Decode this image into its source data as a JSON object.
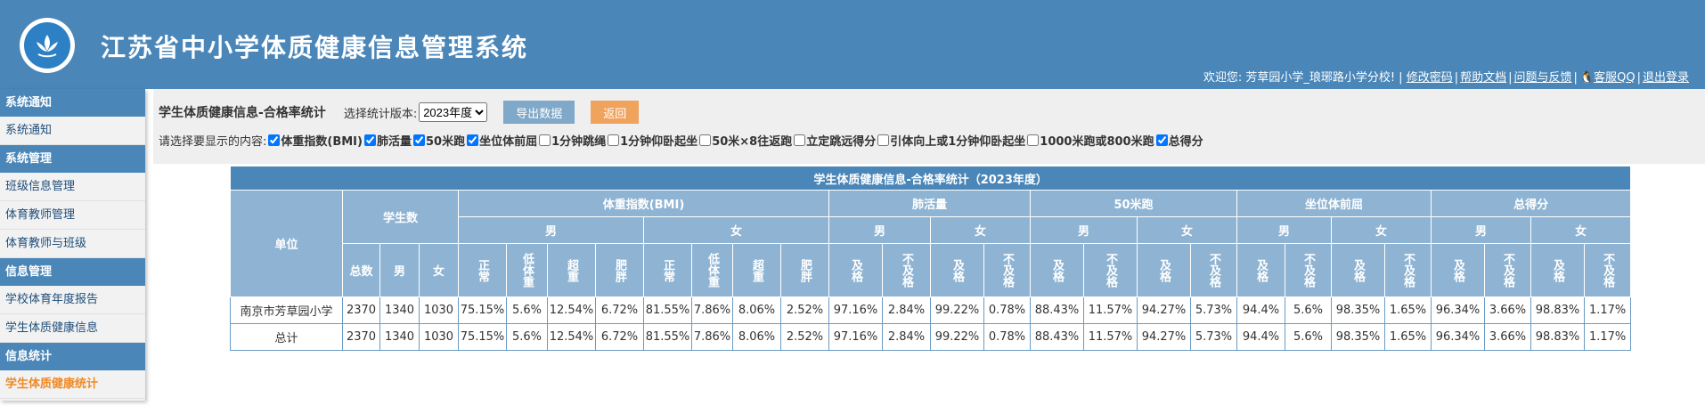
{
  "header": {
    "title": "江苏省中小学体质健康信息管理系统",
    "welcome": "欢迎您: 芳草园小学_琅琊路小学分校! |",
    "links": [
      "修改密码",
      "帮助文档",
      "问题与反馈",
      "客服QQ",
      "退出登录"
    ]
  },
  "sidebar": {
    "groups": [
      {
        "title": "系统通知",
        "items": [
          "系统通知"
        ]
      },
      {
        "title": "系统管理",
        "items": [
          "班级信息管理",
          "体育教师管理",
          "体育教师与班级"
        ]
      },
      {
        "title": "信息管理",
        "items": [
          "学校体育年度报告",
          "学生体质健康信息"
        ]
      },
      {
        "title": "信息统计",
        "items": [
          "学生体质健康统计"
        ]
      }
    ]
  },
  "filter": {
    "page_title": "学生体质健康信息-合格率统计",
    "version_label": "选择统计版本:",
    "version_selected": "2023年度",
    "export_label": "导出数据",
    "back_label": "返回",
    "content_label": "请选择要显示的内容:",
    "options": [
      {
        "label": "体重指数(BMI)",
        "checked": true
      },
      {
        "label": "肺活量",
        "checked": true
      },
      {
        "label": "50米跑",
        "checked": true
      },
      {
        "label": "坐位体前屈",
        "checked": true
      },
      {
        "label": "1分钟跳绳",
        "checked": false
      },
      {
        "label": "1分钟仰卧起坐",
        "checked": false
      },
      {
        "label": "50米×8往返跑",
        "checked": false
      },
      {
        "label": "立定跳远得分",
        "checked": false
      },
      {
        "label": "引体向上或1分钟仰卧起坐",
        "checked": false
      },
      {
        "label": "1000米跑或800米跑",
        "checked": false
      },
      {
        "label": "总得分",
        "checked": true
      }
    ]
  },
  "table": {
    "caption": "学生体质健康信息-合格率统计（2023年度）",
    "unit_header": "单位",
    "count_header": "学生数",
    "count_subs": [
      "总数",
      "男",
      "女"
    ],
    "groups": [
      "体重指数(BMI)",
      "肺活量",
      "50米跑",
      "坐位体前屈",
      "总得分"
    ],
    "sex": [
      "男",
      "女"
    ],
    "bmi_items": [
      "正常",
      "低体重",
      "超重",
      "肥胖"
    ],
    "pass_items": [
      "及格",
      "不及格"
    ],
    "rows": [
      {
        "unit": "南京市芳草园小学",
        "values": [
          "2370",
          "1340",
          "1030",
          "75.15%",
          "5.6%",
          "12.54%",
          "6.72%",
          "81.55%",
          "7.86%",
          "8.06%",
          "2.52%",
          "97.16%",
          "2.84%",
          "99.22%",
          "0.78%",
          "88.43%",
          "11.57%",
          "94.27%",
          "5.73%",
          "94.4%",
          "5.6%",
          "98.35%",
          "1.65%",
          "96.34%",
          "3.66%",
          "98.83%",
          "1.17%"
        ]
      },
      {
        "unit": "总计",
        "values": [
          "2370",
          "1340",
          "1030",
          "75.15%",
          "5.6%",
          "12.54%",
          "6.72%",
          "81.55%",
          "7.86%",
          "8.06%",
          "2.52%",
          "97.16%",
          "2.84%",
          "99.22%",
          "0.78%",
          "88.43%",
          "11.57%",
          "94.27%",
          "5.73%",
          "94.4%",
          "5.6%",
          "98.35%",
          "1.65%",
          "96.34%",
          "3.66%",
          "98.83%",
          "1.17%"
        ]
      }
    ]
  }
}
